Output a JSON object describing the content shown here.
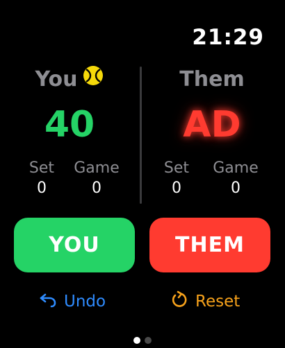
{
  "status_bar": {
    "time": "21:29"
  },
  "you": {
    "name": "You",
    "serving": true,
    "points": "40",
    "set_label": "Set",
    "set_value": "0",
    "game_label": "Game",
    "game_value": "0"
  },
  "them": {
    "name": "Them",
    "serving": false,
    "points": "AD",
    "set_label": "Set",
    "set_value": "0",
    "game_label": "Game",
    "game_value": "0"
  },
  "buttons": {
    "you_label": "YOU",
    "them_label": "THEM",
    "undo_label": "Undo",
    "reset_label": "Reset"
  },
  "page_indicator": {
    "pages": 2,
    "current": 1
  },
  "colors": {
    "you_accent": "#25d366",
    "them_accent": "#ff3b30",
    "undo": "#2f8cff",
    "reset": "#f7a21b",
    "label_gray": "#8e8e93"
  },
  "icons": {
    "serving": "tennis-ball-icon",
    "undo": "undo-arrow-icon",
    "reset": "reset-arrow-icon"
  }
}
